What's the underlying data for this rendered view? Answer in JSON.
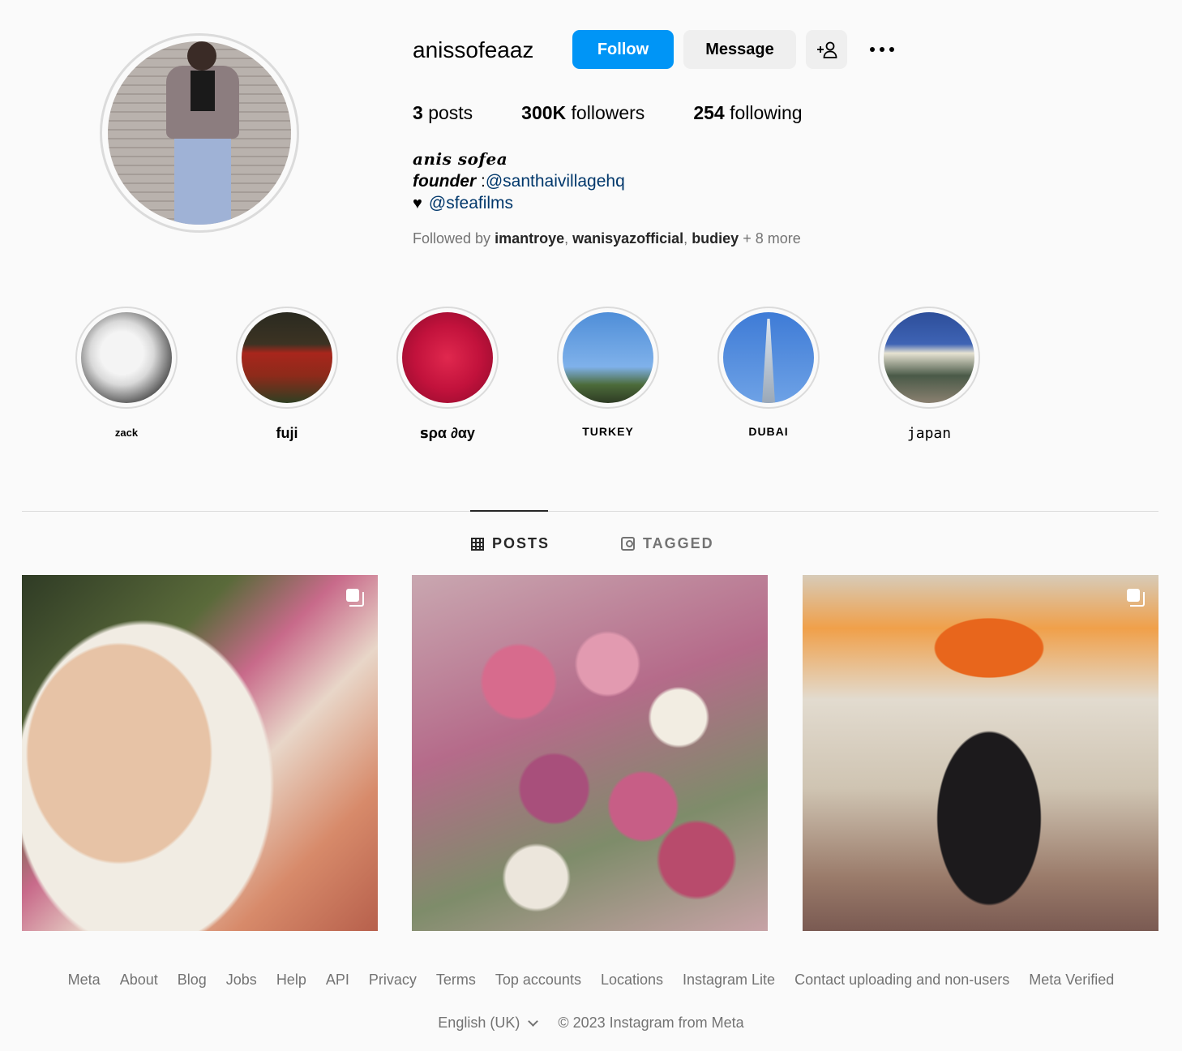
{
  "profile": {
    "username": "anissofeaaz",
    "follow_label": "Follow",
    "message_label": "Message",
    "add_user_label": "+👤",
    "stats": {
      "posts_count": "3",
      "posts_label": "posts",
      "followers_count": "300K",
      "followers_label": "followers",
      "following_count": "254",
      "following_label": "following"
    },
    "bio": {
      "name": "anis sofea",
      "line1_prefix": "founder",
      "line1_sep": " :",
      "line1_link": "@santhaivillagehq",
      "line2_icon": "♥",
      "line2_link": "@sfeafilms"
    },
    "followed_by": {
      "prefix": "Followed by ",
      "users": [
        "imantroye",
        "wanisyazofficial",
        "budiey"
      ],
      "suffix": " + 8 more"
    }
  },
  "highlights": [
    {
      "label": "zack",
      "icon": "cat-photo"
    },
    {
      "label": "fuji",
      "icon": "flower-field-photo"
    },
    {
      "label": "ꜱρα ∂αу",
      "icon": "rose-petals-photo"
    },
    {
      "label": "TURKEY",
      "icon": "mosque-photo"
    },
    {
      "label": "DUBAI",
      "icon": "tower-photo"
    },
    {
      "label": "japan",
      "icon": "castle-photo"
    }
  ],
  "tabs": {
    "posts_label": "POSTS",
    "tagged_label": "TAGGED",
    "active": "posts"
  },
  "posts": [
    {
      "icon": "multi-photo-icon",
      "subject": "selfie"
    },
    {
      "icon": "",
      "subject": "flowers"
    },
    {
      "icon": "multi-photo-icon",
      "subject": "portrait"
    }
  ],
  "footer": {
    "links": [
      "Meta",
      "About",
      "Blog",
      "Jobs",
      "Help",
      "API",
      "Privacy",
      "Terms",
      "Top accounts",
      "Locations",
      "Instagram Lite",
      "Contact uploading and non-users",
      "Meta Verified"
    ],
    "language": "English (UK)",
    "copyright": "© 2023 Instagram from Meta"
  },
  "colors": {
    "accent": "#0095f6",
    "link": "#00376b",
    "muted": "#737373",
    "background": "#fafafa"
  }
}
